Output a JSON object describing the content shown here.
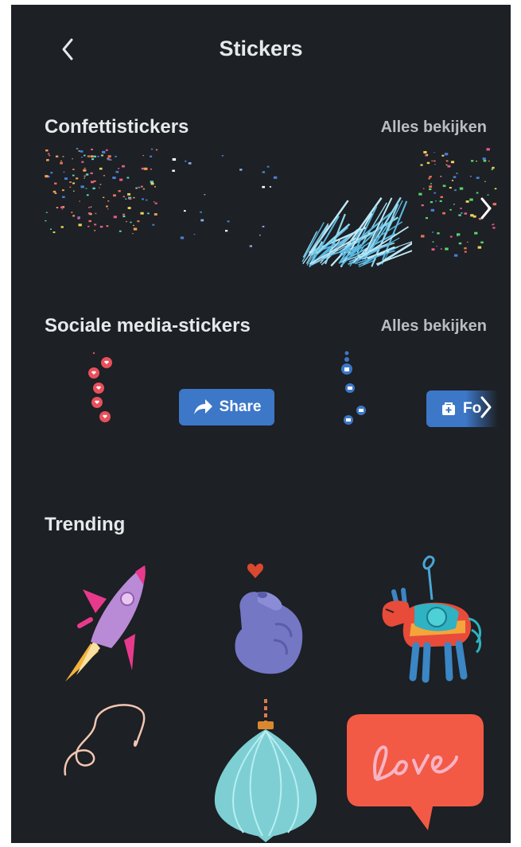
{
  "header": {
    "title": "Stickers",
    "back_icon": "chevron-left-icon"
  },
  "sections": [
    {
      "id": "confetti",
      "title": "Confettistickers",
      "see_all": "Alles bekijken"
    },
    {
      "id": "social",
      "title": "Sociale media-stickers",
      "see_all": "Alles bekijken"
    },
    {
      "id": "trending",
      "title": "Trending"
    }
  ],
  "social_stickers": {
    "share_label": "Share",
    "follow_label_partial": "Fo"
  },
  "colors": {
    "background": "#1d2024",
    "facebook_blue": "#3c77c8",
    "heart_red": "#e8505b",
    "text_primary": "#e6e8ea",
    "text_secondary": "#b9bcc0"
  }
}
